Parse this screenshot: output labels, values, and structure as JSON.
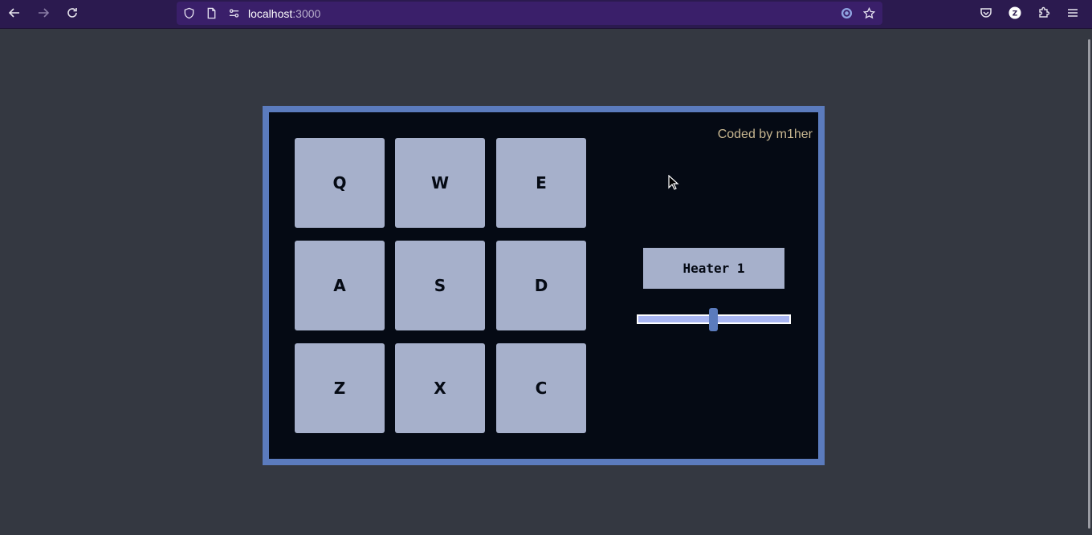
{
  "browser": {
    "url_host": "localhost",
    "url_port": ":3000",
    "icons": [
      "back-arrow-icon",
      "forward-arrow-icon",
      "reload-icon",
      "shield-icon",
      "page-icon",
      "site-permissions-icon",
      "extension-circle-icon",
      "star-icon",
      "pocket-icon",
      "profile-icon",
      "puzzle-icon",
      "menu-icon"
    ],
    "profile_letter": "Z"
  },
  "app": {
    "credit": "Coded by m1her",
    "pads": [
      {
        "key": "Q"
      },
      {
        "key": "W"
      },
      {
        "key": "E"
      },
      {
        "key": "A"
      },
      {
        "key": "S"
      },
      {
        "key": "D"
      },
      {
        "key": "Z"
      },
      {
        "key": "X"
      },
      {
        "key": "C"
      }
    ],
    "display": "Heater 1",
    "volume": 0.5
  },
  "colors": {
    "page_bg": "#343841",
    "toolbar_bg": "#2b1a4f",
    "urlbar_bg": "#3a1f6a",
    "frame_border": "#5b7bbd",
    "machine_bg": "#050a14",
    "pad_bg": "#a6b0cb",
    "credit_text": "#c7b690",
    "slider_track": "#a9b6f2"
  }
}
